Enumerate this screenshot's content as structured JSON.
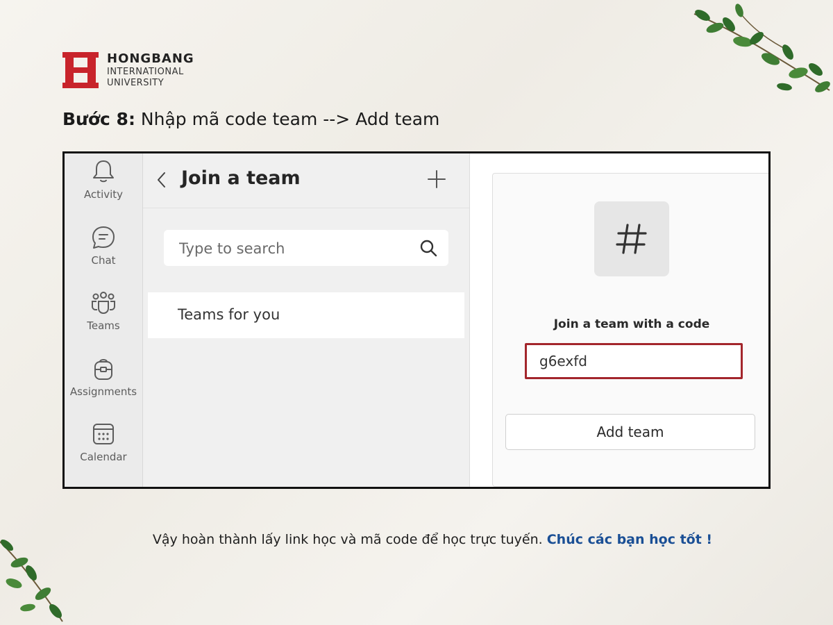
{
  "logo": {
    "line1": "HONGBANG",
    "line2": "INTERNATIONAL",
    "line3": "UNIVERSITY",
    "brand_color": "#c8242b"
  },
  "heading": {
    "step_label": "Bước 8:",
    "text": " Nhập mã code team --> Add team"
  },
  "rail": {
    "items": [
      {
        "label": "Activity",
        "icon": "bell-icon"
      },
      {
        "label": "Chat",
        "icon": "chat-icon"
      },
      {
        "label": "Teams",
        "icon": "teams-icon"
      },
      {
        "label": "Assignments",
        "icon": "assignments-icon"
      },
      {
        "label": "Calendar",
        "icon": "calendar-icon"
      }
    ]
  },
  "list_pane": {
    "title": "Join a team",
    "search_placeholder": "Type to search",
    "teams_for_you": "Teams for you"
  },
  "join_card": {
    "label": "Join a team with a code",
    "code_value": "g6exfd",
    "button_label": "Add team",
    "highlight_color": "#a3262c"
  },
  "footer": {
    "text": "Vậy hoàn thành lấy link học và mã code để học trực tuyến. ",
    "highlight": "Chúc các bạn học tốt !",
    "highlight_color": "#1a4f95"
  }
}
